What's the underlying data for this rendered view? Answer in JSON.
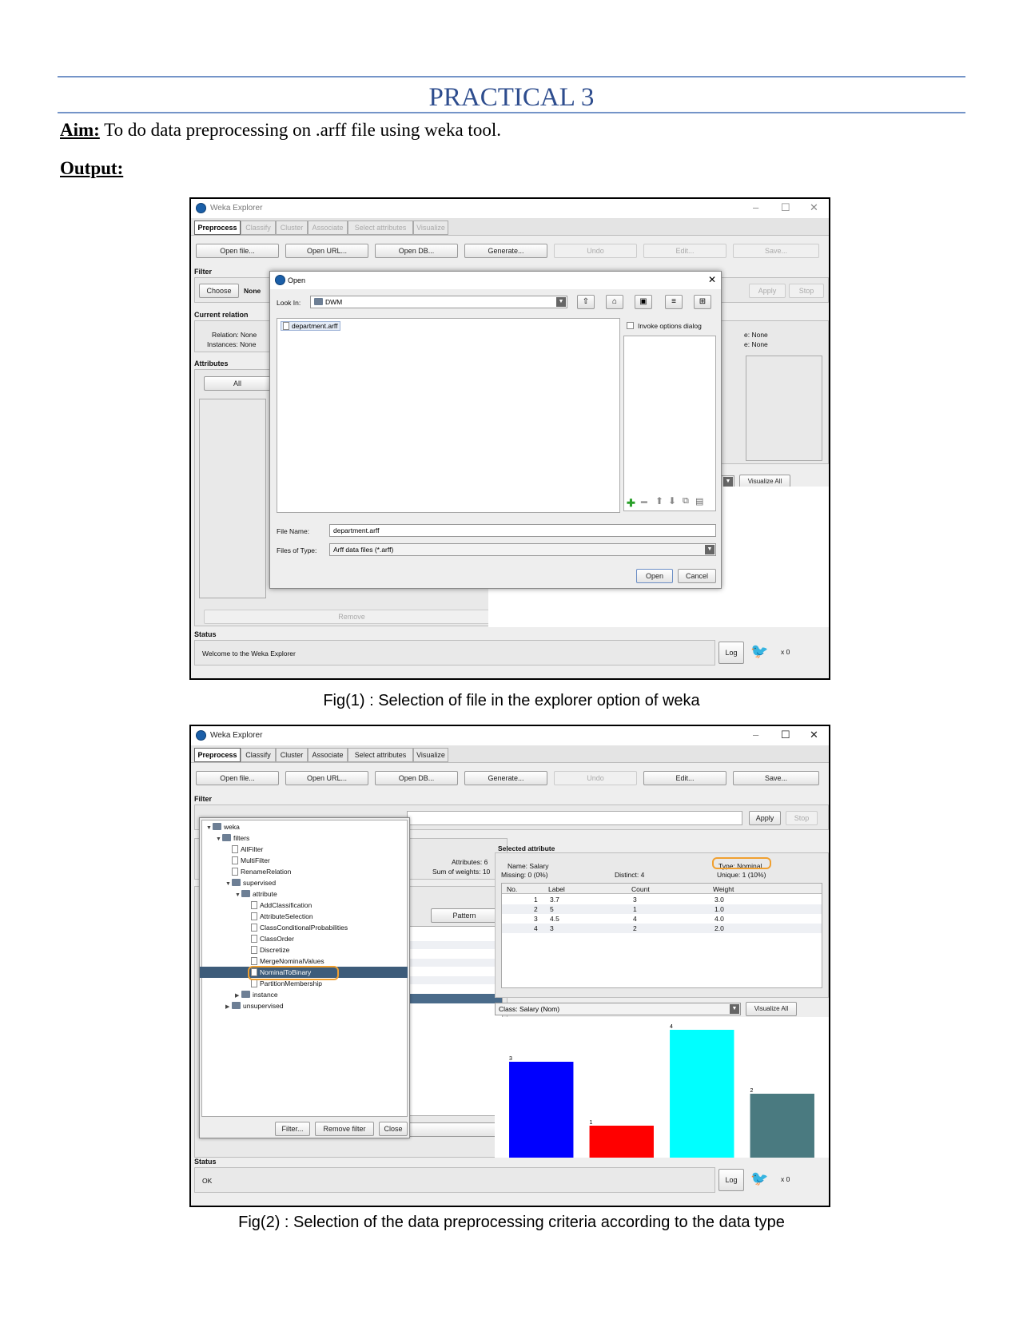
{
  "doc": {
    "title": "PRACTICAL 3",
    "aim_label": "Aim:",
    "aim_text": " To do data preprocessing on .arff file using weka tool.",
    "output_label": "Output:",
    "fig1_caption": "Fig(1) : Selection of file in the explorer option of weka",
    "fig2_caption": "Fig(2) : Selection of the data preprocessing criteria according to the data type"
  },
  "win1": {
    "title": "Weka Explorer",
    "tabs": [
      "Preprocess",
      "Classify",
      "Cluster",
      "Associate",
      "Select attributes",
      "Visualize"
    ],
    "buttons": [
      "Open file...",
      "Open URL...",
      "Open DB...",
      "Generate...",
      "Undo",
      "Edit...",
      "Save..."
    ],
    "filter_label": "Filter",
    "choose": "Choose",
    "none": "None",
    "apply": "Apply",
    "stop": "Stop",
    "current_relation": "Current relation",
    "relation": "Relation: None",
    "instances": "Instances: None",
    "attributes": "Attributes",
    "all": "All",
    "right_none1": "e: None",
    "right_none2": "e: None",
    "visualize_all": "Visualize All",
    "remove": "Remove",
    "status_label": "Status",
    "status_text": "Welcome to the Weka Explorer",
    "log": "Log",
    "x0": "x 0",
    "dialog": {
      "title": "Open",
      "look_in_label": "Look In:",
      "look_in_value": "DWM",
      "file": "department.arff",
      "invoke": "Invoke options dialog",
      "file_name_label": "File Name:",
      "file_name_value": "department.arff",
      "files_type_label": "Files of Type:",
      "files_type_value": "Arff data files (*.arff)",
      "open": "Open",
      "cancel": "Cancel"
    }
  },
  "win2": {
    "title": "Weka Explorer",
    "tabs": [
      "Preprocess",
      "Classify",
      "Cluster",
      "Associate",
      "Select attributes",
      "Visualize"
    ],
    "buttons": [
      "Open file...",
      "Open URL...",
      "Open DB...",
      "Generate...",
      "Undo",
      "Edit...",
      "Save..."
    ],
    "filter_label": "Filter",
    "apply": "Apply",
    "stop": "Stop",
    "tree": [
      "weka",
      "filters",
      "AllFilter",
      "MultiFilter",
      "RenameRelation",
      "supervised",
      "attribute",
      "AddClassification",
      "AttributeSelection",
      "ClassConditionalProbabilities",
      "ClassOrder",
      "Discretize",
      "MergeNominalValues",
      "NominalToBinary",
      "PartitionMembership",
      "instance",
      "unsupervised"
    ],
    "tree_buttons": [
      "Filter...",
      "Remove filter",
      "Close"
    ],
    "attributes_count": "Attributes: 6",
    "sum_weights": "Sum of weights: 10",
    "pattern": "Pattern",
    "selected_attribute": "Selected attribute",
    "name": "Name: Salary",
    "missing": "Missing: 0 (0%)",
    "distinct": "Distinct: 4",
    "type": "Type: Nominal",
    "unique": "Unique: 1 (10%)",
    "table_headers": [
      "No.",
      "Label",
      "Count",
      "Weight"
    ],
    "table_rows": [
      [
        "1",
        "3.7",
        "3",
        "3.0"
      ],
      [
        "2",
        "5",
        "1",
        "1.0"
      ],
      [
        "3",
        "4.5",
        "4",
        "4.0"
      ],
      [
        "4",
        "3",
        "2",
        "2.0"
      ]
    ],
    "class_combo": "Class: Salary (Nom)",
    "visualize_all": "Visualize All",
    "status_label": "Status",
    "status_text": "OK",
    "log": "Log",
    "x0": "x 0"
  },
  "chart_data": {
    "type": "bar",
    "categories": [
      "3.7",
      "5",
      "4.5",
      "3"
    ],
    "values": [
      3,
      1,
      4,
      2
    ],
    "colors": [
      "#0000ff",
      "#ff0000",
      "#00ffff",
      "#4a7a80"
    ],
    "ylim": [
      0,
      4
    ]
  }
}
